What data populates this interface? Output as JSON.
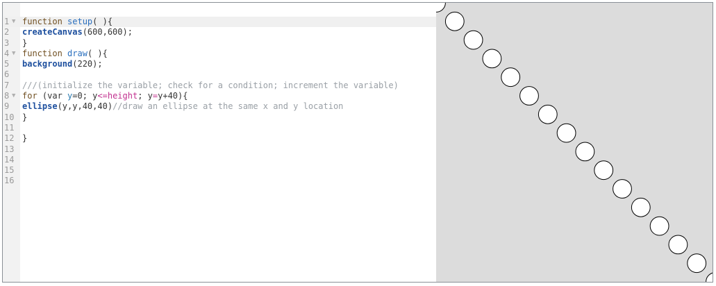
{
  "editor": {
    "line_numbers": [
      "1",
      "2",
      "3",
      "4",
      "5",
      "6",
      "7",
      "8",
      "9",
      "10",
      "11",
      "12",
      "13",
      "14",
      "15",
      "16"
    ],
    "fold_lines": [
      1,
      4,
      8
    ],
    "active_line": 1,
    "lines": [
      [
        {
          "t": "function ",
          "c": "kw"
        },
        {
          "t": "setup",
          "c": "fn"
        },
        {
          "t": "( ){",
          "c": ""
        }
      ],
      [
        {
          "t": "createCanvas",
          "c": "bfn"
        },
        {
          "t": "(600,600);",
          "c": ""
        }
      ],
      [
        {
          "t": "}",
          "c": ""
        }
      ],
      [
        {
          "t": "function ",
          "c": "kw"
        },
        {
          "t": "draw",
          "c": "fn"
        },
        {
          "t": "( ){",
          "c": ""
        }
      ],
      [
        {
          "t": "background",
          "c": "bfn"
        },
        {
          "t": "(220);",
          "c": ""
        }
      ],
      [],
      [
        {
          "t": "///(initialize the variable; check for a condition; increment the variable)",
          "c": "cm"
        }
      ],
      [
        {
          "t": "for ",
          "c": "kw"
        },
        {
          "t": "(var ",
          "c": ""
        },
        {
          "t": "y",
          "c": "var"
        },
        {
          "t": "=0; y",
          "c": ""
        },
        {
          "t": "<=",
          "c": "op"
        },
        {
          "t": "height",
          "c": "op"
        },
        {
          "t": "; y",
          "c": ""
        },
        {
          "t": "=",
          "c": "op"
        },
        {
          "t": "y+40){",
          "c": ""
        }
      ],
      [
        {
          "t": "ellipse",
          "c": "bfn"
        },
        {
          "t": "(y,y,40,40)",
          "c": ""
        },
        {
          "t": "//draw an ellipse at the same x and y location",
          "c": "cm"
        }
      ],
      [
        {
          "t": "}",
          "c": ""
        }
      ],
      [],
      [
        {
          "t": "}",
          "c": ""
        }
      ],
      [],
      [],
      [],
      []
    ]
  },
  "canvas": {
    "background": "#dcdcdc",
    "circle_fill": "#ffffff",
    "circle_stroke": "#000000",
    "canvas_size": 600,
    "ellipse_diameter": 40,
    "y_start": 0,
    "y_step": 40
  }
}
